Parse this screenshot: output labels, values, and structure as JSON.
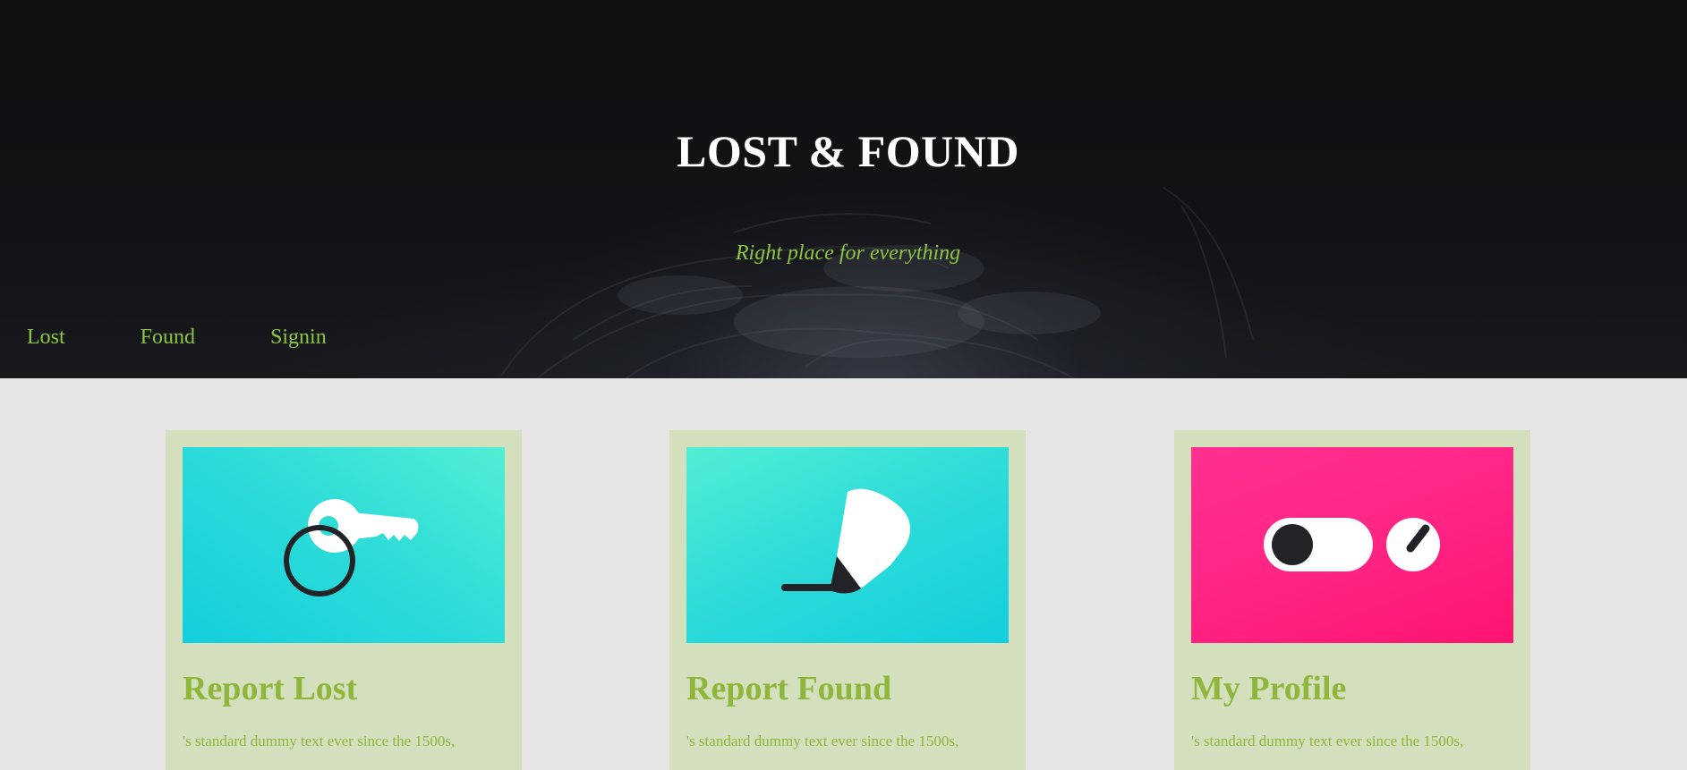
{
  "header": {
    "title": "LOST & FOUND",
    "tagline": "Right place for everything"
  },
  "nav": {
    "items": [
      {
        "label": "Lost"
      },
      {
        "label": "Found"
      },
      {
        "label": "Signin"
      }
    ]
  },
  "cards": [
    {
      "title": "Report Lost",
      "text": "'s standard dummy text ever since the 1500s,",
      "icon": "key-ring-icon",
      "color": "#2fdcd8"
    },
    {
      "title": "Report Found",
      "text": "'s standard dummy text ever since the 1500s,",
      "icon": "marker-pen-icon",
      "color": "#2fdcd8"
    },
    {
      "title": "My Profile",
      "text": "'s standard dummy text ever since the 1500s,",
      "icon": "toggle-switch-icon",
      "color": "#ff2585"
    }
  ],
  "colors": {
    "accent": "#8cc63f",
    "card_bg": "#d4e0bd",
    "page_bg": "#e5e5e5",
    "hero_bg": "#111215"
  }
}
